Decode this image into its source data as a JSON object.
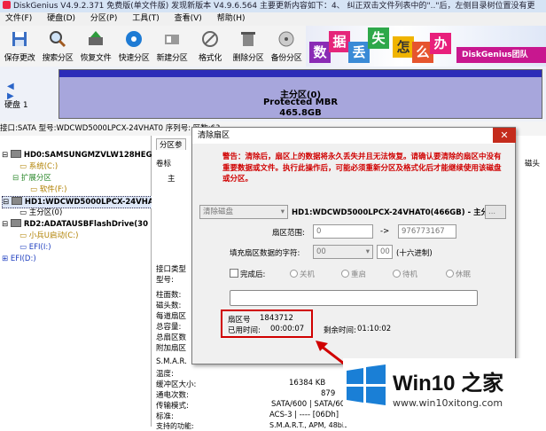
{
  "window": {
    "title": "DiskGenius V4.9.2.371 免费版(单文件版)  发现新版本 V4.9.6.564 主要更新内容如下：4、 纠正双击文件列表中的\"..\"后，左侧目录树位置没有更"
  },
  "menu": [
    "文件(F)",
    "硬盘(D)",
    "分区(P)",
    "工具(T)",
    "查看(V)",
    "帮助(H)"
  ],
  "toolbar": [
    {
      "label": "保存更改",
      "icon": "save-icon"
    },
    {
      "label": "搜索分区",
      "icon": "magnifier-icon"
    },
    {
      "label": "恢复文件",
      "icon": "recover-files-icon"
    },
    {
      "label": "快速分区",
      "icon": "quick-partition-icon"
    },
    {
      "label": "新建分区",
      "icon": "new-partition-icon"
    },
    {
      "label": "格式化",
      "icon": "format-icon"
    },
    {
      "label": "删除分区",
      "icon": "delete-partition-icon"
    },
    {
      "label": "备份分区",
      "icon": "backup-partition-icon"
    }
  ],
  "banner": {
    "chars": [
      "数",
      "据",
      "丢",
      "失",
      "怎",
      "么",
      "办"
    ],
    "brand": "DiskGenius团队"
  },
  "diskbar": {
    "disk_label": "硬盘 1",
    "partition_name": "主分区(0)",
    "partition_type": "Protected MBR",
    "partition_size": "465.8GB"
  },
  "infobar": "接口:SATA  型号:WDCWD5000LPCX-24VHAT0  序列号:                                                                                          区数:63",
  "tree": [
    {
      "text": "HD0:SAMSUNGMZVLW128HEGR-0",
      "depth": 0,
      "kind": "disk"
    },
    {
      "text": "系统(C:)",
      "depth": 1,
      "kind": "part-yellow"
    },
    {
      "text": "扩展分区",
      "depth": 1,
      "kind": "part-green"
    },
    {
      "text": "软件(F:)",
      "depth": 2,
      "kind": "part-yellow"
    },
    {
      "text": "HD1:WDCWD5000LPCX-24VHAT0",
      "depth": 0,
      "kind": "disk",
      "selected": true
    },
    {
      "text": "主分区(0)",
      "depth": 1,
      "kind": "part-plain"
    },
    {
      "text": "RD2:ADATAUSBFlashDrive(30",
      "depth": 0,
      "kind": "disk"
    },
    {
      "text": "小兵U启动(C:)",
      "depth": 1,
      "kind": "part-yellow"
    },
    {
      "text": "EFI(I:)",
      "depth": 1,
      "kind": "part-blue"
    },
    {
      "text": "EFI(D:)",
      "depth": 0,
      "kind": "part-blue"
    }
  ],
  "right_panel": {
    "tab": "分区参",
    "col_label": "卷标",
    "col_main": "主",
    "col_heads": "磁头",
    "labels": [
      "接口类型",
      "型号:",
      "柱面数:",
      "磁头数:",
      "每道扇区",
      "总容量:",
      "总扇区数",
      "附加扇区",
      "S.M.A.R.",
      "温度:",
      "缓冲区大小:",
      "通电次数:",
      "传输模式:",
      "标准:",
      "支持的功能:"
    ],
    "values": {
      "buffer": "16384 KB",
      "power_on": "879",
      "transfer": "SATA/600 | SATA/600",
      "standard": "ACS-3 | ---- [06Dh]",
      "features": "S.M.A.R.T., APM, 48bit"
    }
  },
  "dialog": {
    "title": "清除扇区",
    "close": "✕",
    "warning": "警告：清除后，扇区上的数据将永久丢失并且无法恢复。请确认要清除的扇区中没有重要数据或文件。执行此操作后，可能必须重新分区及格式化后才能继续使用该磁盘或分区。",
    "mode_select": "清除磁盘",
    "target": "HD1:WDCWD5000LPCX-24VHAT0(466GB) - 主分",
    "range_label": "扇区范围:",
    "range_start": "0",
    "range_arrow": "->",
    "range_end": "976773167",
    "fill_label": "填充扇区数据的字符:",
    "fill_value": "00",
    "fill_hex": "00",
    "fill_suffix": "(十六进制)",
    "after_label": "完成后:",
    "options": [
      "关机",
      "重启",
      "待机",
      "休眠"
    ],
    "sector_label": "扇区号",
    "sector_value": "1843712",
    "elapsed_label": "已用时间:",
    "elapsed_value": "00:00:07",
    "remaining_label": "剩余时间:",
    "remaining_value": "01:10:02"
  },
  "watermark": {
    "brand": "Win10 之家",
    "url": "www.win10xitong.com"
  },
  "colors": {
    "partition": "#a7a6dc",
    "warning": "#d00000",
    "watermark_blue": "#1a7fd6",
    "highlight_box": "#d00000"
  }
}
